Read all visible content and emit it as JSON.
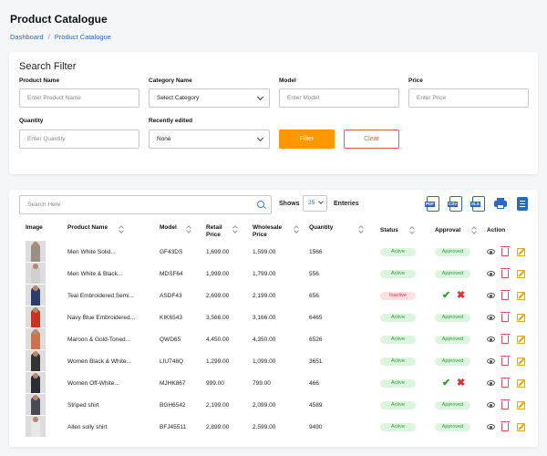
{
  "header": {
    "title": "Product Catalogue",
    "breadcrumb": [
      "Dashboard",
      "Product Catalogue"
    ]
  },
  "filter": {
    "title": "Search Filter",
    "product_name": {
      "label": "Product Name",
      "placeholder": "Enter Product Name"
    },
    "category": {
      "label": "Category Name",
      "value": "Select Category"
    },
    "model": {
      "label": "Model",
      "placeholder": "Enter Model"
    },
    "price": {
      "label": "Price",
      "placeholder": "Enter Price"
    },
    "quantity": {
      "label": "Quantity",
      "placeholder": "Enter Quantity"
    },
    "recent": {
      "label": "Recently edited",
      "value": "None"
    },
    "filter_label": "Filter",
    "clear_label": "Clear"
  },
  "toolbar": {
    "search_placeholder": "Search Here",
    "shows_label": "Shows",
    "shows_value": "25",
    "entries_label": "Enteries",
    "exports": [
      "PDF",
      "CSV",
      "XLS"
    ]
  },
  "colors": {
    "accent": "#ff9700",
    "primary": "#2a67c9",
    "danger": "#e35d4e",
    "success": "#2a9d3a"
  },
  "table": {
    "headers": {
      "image": "Image",
      "product_name": "Product Name",
      "model": "Model",
      "retail": [
        "Retail",
        "Price"
      ],
      "wholesale": [
        "Wholesale",
        "Price"
      ],
      "quantity": "Quantity",
      "status": "Status",
      "approval": "Approval",
      "action": "Action"
    },
    "rows": [
      {
        "name": "Men White Solid...",
        "model": "GF43DS",
        "retail": "1,699.00",
        "wholesale": "1,599.00",
        "qty": "1566",
        "status": "Active",
        "approval": "Approved",
        "color": "#9a8f85"
      },
      {
        "name": "Men White & Black...",
        "model": "MDSF64",
        "retail": "1,999.00",
        "wholesale": "1,799.00",
        "qty": "556",
        "status": "Active",
        "approval": "Approved",
        "color": "#cfcfcf"
      },
      {
        "name": "Teal Embroidered Semi...",
        "model": "ASDF43",
        "retail": "2,699.00",
        "wholesale": "2,199.00",
        "qty": "656",
        "status": "Inactive",
        "approval": "pending",
        "color": "#2b3d6a"
      },
      {
        "name": "Navy Blue Embroidered...",
        "model": "KIK6543",
        "retail": "3,566.00",
        "wholesale": "3,166.00",
        "qty": "6465",
        "status": "Active",
        "approval": "Approved",
        "color": "#c8321f"
      },
      {
        "name": "Maroon & Gold-Toned...",
        "model": "QWD65",
        "retail": "4,450.00",
        "wholesale": "4,350.00",
        "qty": "6526",
        "status": "Active",
        "approval": "Approved",
        "color": "#c9744a"
      },
      {
        "name": "Women Black & White...",
        "model": "LIU748Q",
        "retail": "1,299.00",
        "wholesale": "1,099.00",
        "qty": "3651",
        "status": "Active",
        "approval": "Approved",
        "color": "#333333"
      },
      {
        "name": "Women Off-White...",
        "model": "MJHK867",
        "retail": "999.00",
        "wholesale": "799.00",
        "qty": "466",
        "status": "Active",
        "approval": "pending",
        "color": "#2c2c34"
      },
      {
        "name": "Striped shirt",
        "model": "BGH6542",
        "retail": "2,199.00",
        "wholesale": "2,099.00",
        "qty": "4589",
        "status": "Active",
        "approval": "Approved",
        "color": "#4a4a55"
      },
      {
        "name": "Allen solly shirt",
        "model": "BFJ45511",
        "retail": "2,899.00",
        "wholesale": "2,599.00",
        "qty": "9490",
        "status": "Active",
        "approval": "Approved",
        "color": "#e8e8e8"
      }
    ]
  }
}
